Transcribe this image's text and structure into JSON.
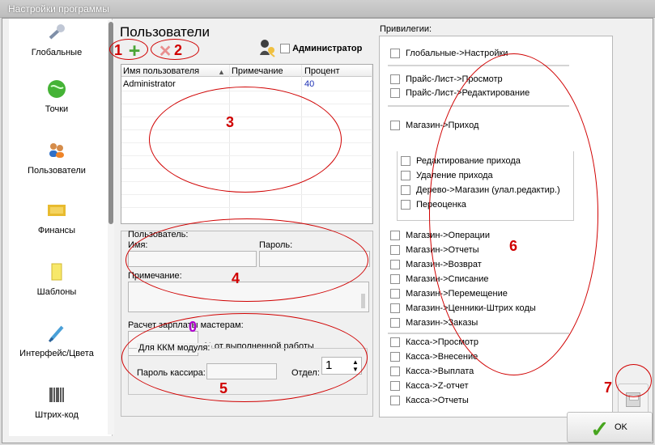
{
  "window": {
    "title": "Настройки программы"
  },
  "sidebar": {
    "items": [
      {
        "label": "Глобальные",
        "icon": "wrench-icon"
      },
      {
        "label": "Точки",
        "icon": "globe-icon"
      },
      {
        "label": "Пользователи",
        "icon": "users-icon"
      },
      {
        "label": "Финансы",
        "icon": "money-icon"
      },
      {
        "label": "Шаблоны",
        "icon": "note-icon"
      },
      {
        "label": "Интерфейс/Цвета",
        "icon": "brush-icon"
      },
      {
        "label": "Штрих-код",
        "icon": "barcode-icon"
      }
    ]
  },
  "users": {
    "title": "Пользователи",
    "admin_label": "Администратор",
    "columns": [
      "Имя пользователя",
      "Примечание",
      "Процент"
    ],
    "rows": [
      {
        "name": "Administrator",
        "note": "",
        "percent": "40"
      }
    ]
  },
  "user_form": {
    "group_label": "Пользователь:",
    "name_label": "Имя:",
    "password_label": "Пароль:",
    "note_label": "Примечание:",
    "salary_label": "Расчет зарплаты мастерам:",
    "percent_suffix": "% от выполненной работы",
    "kkm_label": "Для ККМ модуля:",
    "cashier_password_label": "Пароль кассира:",
    "department_label": "Отдел:",
    "department_value": "1"
  },
  "privileges": {
    "title": "Привилегии:",
    "items": [
      "Глобальные->Настройки",
      "Прайс-Лист->Просмотр",
      "Прайс-Лист->Редактирование",
      "Магазин->Приход",
      "Редактирование прихода",
      "Удаление прихода",
      "Дерево->Магазин (улал.редактир.)",
      "Переоценка",
      "Магазин->Операции",
      "Магазин->Отчеты",
      "Магазин->Возврат",
      "Магазин->Списание",
      "Магазин->Перемещение",
      "Магазин->Ценники-Штрих коды",
      "Магазин->Заказы",
      "Касса->Просмотр",
      "Касса->Внесение",
      "Касса->Выплата",
      "Касса->Z-отчет",
      "Касса->Отчеты"
    ]
  },
  "annotations": [
    "1",
    "2",
    "3",
    "4",
    "5",
    "6",
    "7",
    "0"
  ],
  "buttons": {
    "ok_label": "OK"
  },
  "colors": {
    "annotation": "#d00000",
    "annotation_zero": "#b000d0",
    "ok_check": "#47a51f"
  }
}
